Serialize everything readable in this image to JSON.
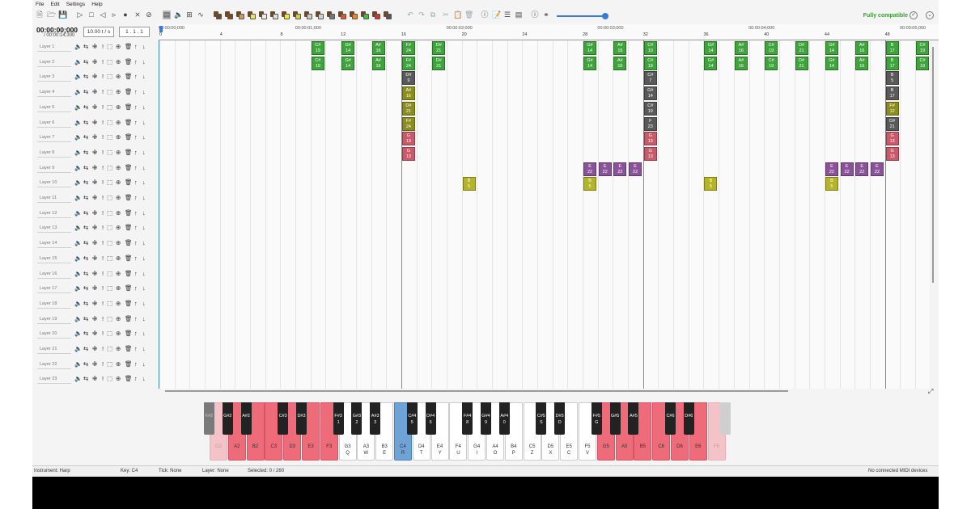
{
  "menu": [
    "File",
    "Edit",
    "Settings",
    "Help"
  ],
  "toolbar": {
    "compat_label": "Fully compatible"
  },
  "time": {
    "current": "00:00:00;000",
    "total": "/ 00:00:14;300",
    "tempo": "10.00 t / s",
    "position": "1 . 1 . 1"
  },
  "ruler": {
    "times": [
      "00:00:00;000",
      "00:00:01;000",
      "00:00:02;000",
      "00:00:03;000",
      "00:00:04;000",
      "00:00:05;000"
    ],
    "ticks": [
      "0",
      "4",
      "8",
      "12",
      "16",
      "20",
      "24",
      "28",
      "32",
      "36",
      "40",
      "44",
      "48"
    ]
  },
  "layers": [
    "Layer 1",
    "Layer 2",
    "Layer 3",
    "Layer 4",
    "Layer 5",
    "Layer 6",
    "Layer 7",
    "Layer 8",
    "Layer 9",
    "Layer 10",
    "Layer 11",
    "Layer 12",
    "Layer 13",
    "Layer 14",
    "Layer 15",
    "Layer 16",
    "Layer 17",
    "Layer 18",
    "Layer 19",
    "Layer 20",
    "Layer 21",
    "Layer 22",
    "Layer 23"
  ],
  "colors": {
    "harp_green": "#3ea43b",
    "dark_gray": "#5a5a5a",
    "olive": "#8b8e1e",
    "pink": "#c95a6a",
    "purple": "#8a5299",
    "yellow": "#b3b526",
    "accent": "#3a7bd5",
    "active_key": "#ee6b7a",
    "faded_key": "#f4c3c8",
    "selected_key": "#6fa3d6"
  },
  "notes": [
    {
      "layer": 1,
      "tick": 10,
      "key": "C#",
      "num": "19",
      "color": "harp_green"
    },
    {
      "layer": 2,
      "tick": 10,
      "key": "C#",
      "num": "19",
      "color": "harp_green"
    },
    {
      "layer": 1,
      "tick": 12,
      "key": "G#",
      "num": "14",
      "color": "harp_green"
    },
    {
      "layer": 2,
      "tick": 12,
      "key": "G#",
      "num": "14",
      "color": "harp_green"
    },
    {
      "layer": 1,
      "tick": 14,
      "key": "A#",
      "num": "16",
      "color": "harp_green"
    },
    {
      "layer": 2,
      "tick": 14,
      "key": "A#",
      "num": "16",
      "color": "harp_green"
    },
    {
      "layer": 1,
      "tick": 16,
      "key": "F#",
      "num": "24",
      "color": "harp_green"
    },
    {
      "layer": 2,
      "tick": 16,
      "key": "F#",
      "num": "24",
      "color": "harp_green"
    },
    {
      "layer": 3,
      "tick": 16,
      "key": "D#",
      "num": "9",
      "color": "dark_gray"
    },
    {
      "layer": 4,
      "tick": 16,
      "key": "A#",
      "num": "16",
      "color": "olive"
    },
    {
      "layer": 5,
      "tick": 16,
      "key": "D#",
      "num": "21",
      "color": "olive"
    },
    {
      "layer": 6,
      "tick": 16,
      "key": "F#",
      "num": "24",
      "color": "olive"
    },
    {
      "layer": 7,
      "tick": 16,
      "key": "G",
      "num": "13",
      "color": "pink"
    },
    {
      "layer": 8,
      "tick": 16,
      "key": "G",
      "num": "13",
      "color": "pink"
    },
    {
      "layer": 1,
      "tick": 18,
      "key": "D#",
      "num": "21",
      "color": "harp_green"
    },
    {
      "layer": 2,
      "tick": 18,
      "key": "D#",
      "num": "21",
      "color": "harp_green"
    },
    {
      "layer": 10,
      "tick": 20,
      "key": "B",
      "num": "5",
      "color": "yellow"
    },
    {
      "layer": 1,
      "tick": 28,
      "key": "G#",
      "num": "14",
      "color": "harp_green"
    },
    {
      "layer": 2,
      "tick": 28,
      "key": "G#",
      "num": "14",
      "color": "harp_green"
    },
    {
      "layer": 9,
      "tick": 28,
      "key": "E",
      "num": "22",
      "color": "purple"
    },
    {
      "layer": 10,
      "tick": 28,
      "key": "B",
      "num": "5",
      "color": "yellow"
    },
    {
      "layer": 9,
      "tick": 29,
      "key": "E",
      "num": "22",
      "color": "purple"
    },
    {
      "layer": 1,
      "tick": 30,
      "key": "A#",
      "num": "16",
      "color": "harp_green"
    },
    {
      "layer": 2,
      "tick": 30,
      "key": "A#",
      "num": "16",
      "color": "harp_green"
    },
    {
      "layer": 9,
      "tick": 30,
      "key": "E",
      "num": "22",
      "color": "purple"
    },
    {
      "layer": 9,
      "tick": 31,
      "key": "E",
      "num": "22",
      "color": "purple"
    },
    {
      "layer": 1,
      "tick": 32,
      "key": "C#",
      "num": "19",
      "color": "harp_green"
    },
    {
      "layer": 2,
      "tick": 32,
      "key": "C#",
      "num": "19",
      "color": "harp_green"
    },
    {
      "layer": 3,
      "tick": 32,
      "key": "C#",
      "num": "7",
      "color": "dark_gray"
    },
    {
      "layer": 4,
      "tick": 32,
      "key": "G#",
      "num": "14",
      "color": "dark_gray"
    },
    {
      "layer": 5,
      "tick": 32,
      "key": "C#",
      "num": "19",
      "color": "dark_gray"
    },
    {
      "layer": 6,
      "tick": 32,
      "key": "F",
      "num": "23",
      "color": "dark_gray"
    },
    {
      "layer": 7,
      "tick": 32,
      "key": "G",
      "num": "13",
      "color": "pink"
    },
    {
      "layer": 8,
      "tick": 32,
      "key": "G",
      "num": "13",
      "color": "pink"
    },
    {
      "layer": 1,
      "tick": 36,
      "key": "G#",
      "num": "14",
      "color": "harp_green"
    },
    {
      "layer": 2,
      "tick": 36,
      "key": "G#",
      "num": "14",
      "color": "harp_green"
    },
    {
      "layer": 10,
      "tick": 36,
      "key": "B",
      "num": "5",
      "color": "yellow"
    },
    {
      "layer": 1,
      "tick": 38,
      "key": "A#",
      "num": "16",
      "color": "harp_green"
    },
    {
      "layer": 2,
      "tick": 38,
      "key": "A#",
      "num": "16",
      "color": "harp_green"
    },
    {
      "layer": 1,
      "tick": 40,
      "key": "C#",
      "num": "19",
      "color": "harp_green"
    },
    {
      "layer": 2,
      "tick": 40,
      "key": "C#",
      "num": "19",
      "color": "harp_green"
    },
    {
      "layer": 1,
      "tick": 42,
      "key": "D#",
      "num": "21",
      "color": "harp_green"
    },
    {
      "layer": 2,
      "tick": 42,
      "key": "D#",
      "num": "21",
      "color": "harp_green"
    },
    {
      "layer": 1,
      "tick": 44,
      "key": "G#",
      "num": "14",
      "color": "harp_green"
    },
    {
      "layer": 2,
      "tick": 44,
      "key": "G#",
      "num": "14",
      "color": "harp_green"
    },
    {
      "layer": 9,
      "tick": 44,
      "key": "E",
      "num": "22",
      "color": "purple"
    },
    {
      "layer": 10,
      "tick": 44,
      "key": "B",
      "num": "5",
      "color": "yellow"
    },
    {
      "layer": 9,
      "tick": 45,
      "key": "E",
      "num": "22",
      "color": "purple"
    },
    {
      "layer": 1,
      "tick": 46,
      "key": "A#",
      "num": "16",
      "color": "harp_green"
    },
    {
      "layer": 2,
      "tick": 46,
      "key": "A#",
      "num": "16",
      "color": "harp_green"
    },
    {
      "layer": 9,
      "tick": 46,
      "key": "E",
      "num": "22",
      "color": "purple"
    },
    {
      "layer": 9,
      "tick": 47,
      "key": "E",
      "num": "22",
      "color": "purple"
    },
    {
      "layer": 1,
      "tick": 48,
      "key": "B",
      "num": "17",
      "color": "harp_green"
    },
    {
      "layer": 2,
      "tick": 48,
      "key": "B",
      "num": "17",
      "color": "harp_green"
    },
    {
      "layer": 3,
      "tick": 48,
      "key": "B",
      "num": "5",
      "color": "dark_gray"
    },
    {
      "layer": 4,
      "tick": 48,
      "key": "B",
      "num": "17",
      "color": "dark_gray"
    },
    {
      "layer": 5,
      "tick": 48,
      "key": "F#",
      "num": "12",
      "color": "olive"
    },
    {
      "layer": 6,
      "tick": 48,
      "key": "D#",
      "num": "21",
      "color": "dark_gray"
    },
    {
      "layer": 7,
      "tick": 48,
      "key": "G",
      "num": "13",
      "color": "pink"
    },
    {
      "layer": 8,
      "tick": 48,
      "key": "G",
      "num": "13",
      "color": "pink"
    },
    {
      "layer": 1,
      "tick": 50,
      "key": "C#",
      "num": "19",
      "color": "harp_green"
    },
    {
      "layer": 2,
      "tick": 50,
      "key": "C#",
      "num": "19",
      "color": "harp_green"
    }
  ],
  "piano": {
    "white_keys": [
      {
        "note": "G2",
        "bind": "",
        "state": "faded"
      },
      {
        "note": "A2",
        "bind": "",
        "state": "active"
      },
      {
        "note": "B2",
        "bind": "",
        "state": "active"
      },
      {
        "note": "C3",
        "bind": "",
        "state": "active"
      },
      {
        "note": "D3",
        "bind": "",
        "state": "active"
      },
      {
        "note": "E3",
        "bind": "",
        "state": "active"
      },
      {
        "note": "F3",
        "bind": "",
        "state": "active"
      },
      {
        "note": "G3",
        "bind": "Q",
        "state": "normal"
      },
      {
        "note": "A3",
        "bind": "W",
        "state": "normal"
      },
      {
        "note": "B3",
        "bind": "E",
        "state": "normal"
      },
      {
        "note": "C4",
        "bind": "R",
        "state": "selected"
      },
      {
        "note": "D4",
        "bind": "T",
        "state": "normal"
      },
      {
        "note": "E4",
        "bind": "Y",
        "state": "normal"
      },
      {
        "note": "F4",
        "bind": "U",
        "state": "normal"
      },
      {
        "note": "G4",
        "bind": "I",
        "state": "normal"
      },
      {
        "note": "A4",
        "bind": "O",
        "state": "normal"
      },
      {
        "note": "B4",
        "bind": "P",
        "state": "normal"
      },
      {
        "note": "C5",
        "bind": "Z",
        "state": "normal"
      },
      {
        "note": "D5",
        "bind": "X",
        "state": "normal"
      },
      {
        "note": "E5",
        "bind": "C",
        "state": "normal"
      },
      {
        "note": "F5",
        "bind": "V",
        "state": "normal"
      },
      {
        "note": "G5",
        "bind": "",
        "state": "active"
      },
      {
        "note": "A5",
        "bind": "",
        "state": "active"
      },
      {
        "note": "B5",
        "bind": "",
        "state": "active"
      },
      {
        "note": "C6",
        "bind": "",
        "state": "active"
      },
      {
        "note": "D6",
        "bind": "",
        "state": "active"
      },
      {
        "note": "E6",
        "bind": "",
        "state": "active"
      },
      {
        "note": "F6",
        "bind": "",
        "state": "faded"
      }
    ],
    "black_keys": [
      {
        "note": "F#2",
        "bind": "",
        "after": 0,
        "state": "faded"
      },
      {
        "note": "G#2",
        "bind": "",
        "after": 1,
        "state": "normal"
      },
      {
        "note": "A#2",
        "bind": "",
        "after": 2,
        "state": "normal"
      },
      {
        "note": "C#3",
        "bind": "",
        "after": 4,
        "state": "normal"
      },
      {
        "note": "D#3",
        "bind": "",
        "after": 5,
        "state": "normal"
      },
      {
        "note": "F#3",
        "bind": "1",
        "after": 7,
        "state": "normal"
      },
      {
        "note": "G#3",
        "bind": "2",
        "after": 8,
        "state": "normal"
      },
      {
        "note": "A#3",
        "bind": "3",
        "after": 9,
        "state": "normal"
      },
      {
        "note": "C#4",
        "bind": "5",
        "after": 11,
        "state": "normal"
      },
      {
        "note": "D#4",
        "bind": "6",
        "after": 12,
        "state": "normal"
      },
      {
        "note": "F#4",
        "bind": "8",
        "after": 14,
        "state": "normal"
      },
      {
        "note": "G#4",
        "bind": "9",
        "after": 15,
        "state": "normal"
      },
      {
        "note": "A#4",
        "bind": "0",
        "after": 16,
        "state": "normal"
      },
      {
        "note": "C#5",
        "bind": "S",
        "after": 18,
        "state": "normal"
      },
      {
        "note": "D#5",
        "bind": "D",
        "after": 19,
        "state": "normal"
      },
      {
        "note": "F#5",
        "bind": "G",
        "after": 21,
        "state": "normal"
      },
      {
        "note": "G#5",
        "bind": "",
        "after": 22,
        "state": "normal"
      },
      {
        "note": "A#5",
        "bind": "",
        "after": 23,
        "state": "normal"
      },
      {
        "note": "C#6",
        "bind": "",
        "after": 25,
        "state": "normal"
      },
      {
        "note": "D#6",
        "bind": "",
        "after": 26,
        "state": "normal"
      },
      {
        "note": "",
        "bind": "",
        "after": 28,
        "state": "faded"
      }
    ]
  },
  "status": {
    "instrument": "Instrument: Harp",
    "key": "Key: C4",
    "tick": "Tick: None",
    "layer": "Layer: None",
    "selected": "Selected: 0 / 260",
    "midi": "No connected MIDI devices"
  }
}
